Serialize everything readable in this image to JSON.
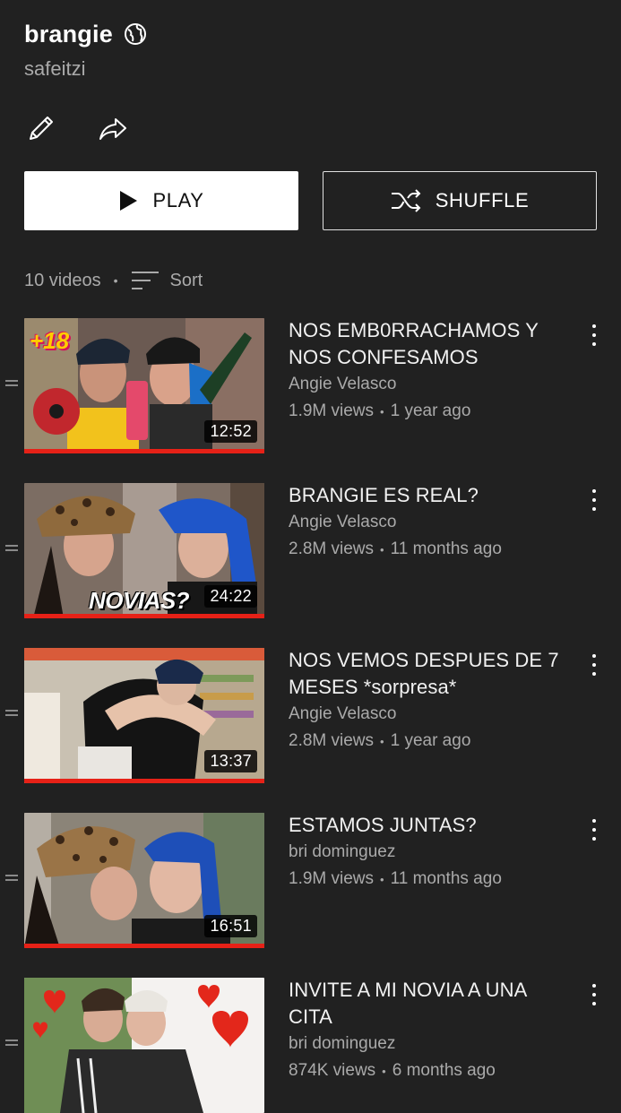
{
  "playlist": {
    "title": "brangie",
    "owner": "safeitzi",
    "video_count": "10 videos",
    "sort_label": "Sort"
  },
  "actions": {
    "play_label": "PLAY",
    "shuffle_label": "SHUFFLE"
  },
  "icons": {
    "visibility": "globe-icon",
    "edit": "pencil-icon",
    "share": "share-arrow-icon",
    "play": "play-icon",
    "shuffle": "shuffle-icon",
    "sort": "sort-icon",
    "drag": "drag-handle-icon",
    "more": "more-vertical-icon"
  },
  "colors": {
    "background": "#212121",
    "progress": "#e62117",
    "secondary_text": "#aaaaaa"
  },
  "videos": [
    {
      "title": "NOS EMB0RRACHAMOS Y NOS CONFESAMOS",
      "channel": "Angie Velasco",
      "views": "1.9M views",
      "age": "1 year ago",
      "duration": "12:52",
      "watched_fraction": 1.0,
      "overlay_text": "+18"
    },
    {
      "title": "BRANGIE ES REAL?",
      "channel": "Angie Velasco",
      "views": "2.8M views",
      "age": "11 months ago",
      "duration": "24:22",
      "watched_fraction": 1.0,
      "overlay_text": "NOVIAS?"
    },
    {
      "title": "NOS VEMOS DESPUES DE 7 MESES *sorpresa*",
      "channel": "Angie Velasco",
      "views": "2.8M views",
      "age": "1 year ago",
      "duration": "13:37",
      "watched_fraction": 1.0
    },
    {
      "title": "ESTAMOS JUNTAS?",
      "channel": "bri dominguez",
      "views": "1.9M views",
      "age": "11 months ago",
      "duration": "16:51",
      "watched_fraction": 1.0
    },
    {
      "title": "INVITE A MI NOVIA A UNA CITA",
      "channel": "bri dominguez",
      "views": "874K views",
      "age": "6 months ago"
    }
  ]
}
